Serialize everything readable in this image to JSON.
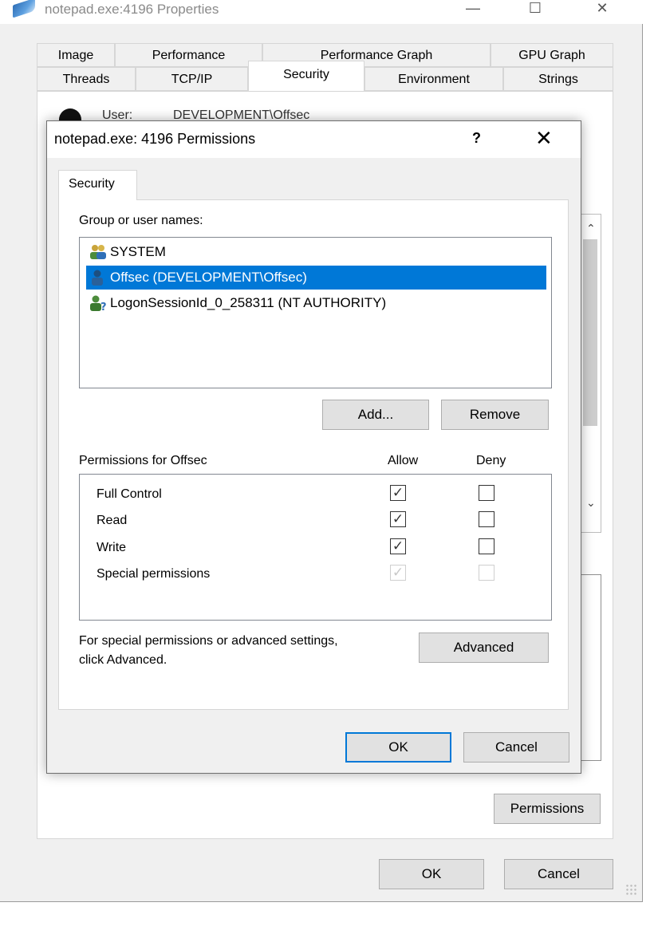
{
  "outer_window": {
    "title": "notepad.exe:4196 Properties",
    "caption_buttons": [
      "—",
      "☐",
      "✕"
    ],
    "tabs_row1": [
      "Image",
      "Performance",
      "Performance Graph",
      "GPU Graph"
    ],
    "tabs_row2": [
      "Threads",
      "TCP/IP",
      "Security",
      "Environment",
      "Strings"
    ],
    "active_tab": "Security",
    "user_label": "User:",
    "user_value": "DEVELOPMENT\\Offsec",
    "permissions_button": "Permissions",
    "ok_button": "OK",
    "cancel_button": "Cancel"
  },
  "dialog": {
    "title": "notepad.exe: 4196 Permissions",
    "help_glyph": "?",
    "close_glyph": "✕",
    "tab": "Security",
    "group_label": "Group or user names:",
    "users": [
      {
        "name": "SYSTEM",
        "icon": "users-group-icon",
        "selected": false
      },
      {
        "name": "Offsec (DEVELOPMENT\\Offsec)",
        "icon": "user-icon",
        "selected": true
      },
      {
        "name": "LogonSessionId_0_258311 (NT AUTHORITY)",
        "icon": "unknown-user-icon",
        "selected": false
      }
    ],
    "add_button": "Add...",
    "remove_button": "Remove",
    "permissions_for_label": "Permissions for Offsec",
    "allow_header": "Allow",
    "deny_header": "Deny",
    "permissions": [
      {
        "name": "Full Control",
        "allow": true,
        "deny": false,
        "disabled": false
      },
      {
        "name": "Read",
        "allow": true,
        "deny": false,
        "disabled": false
      },
      {
        "name": "Write",
        "allow": true,
        "deny": false,
        "disabled": false
      },
      {
        "name": "Special permissions",
        "allow": true,
        "deny": false,
        "disabled": true
      }
    ],
    "advanced_text_line1": "For special permissions or advanced settings,",
    "advanced_text_line2": "click Advanced.",
    "advanced_button": "Advanced",
    "ok_button": "OK",
    "cancel_button": "Cancel"
  },
  "colors": {
    "selection": "#0078d7",
    "default_button_border": "#0078d7",
    "window_bg": "#f0f0f0"
  }
}
